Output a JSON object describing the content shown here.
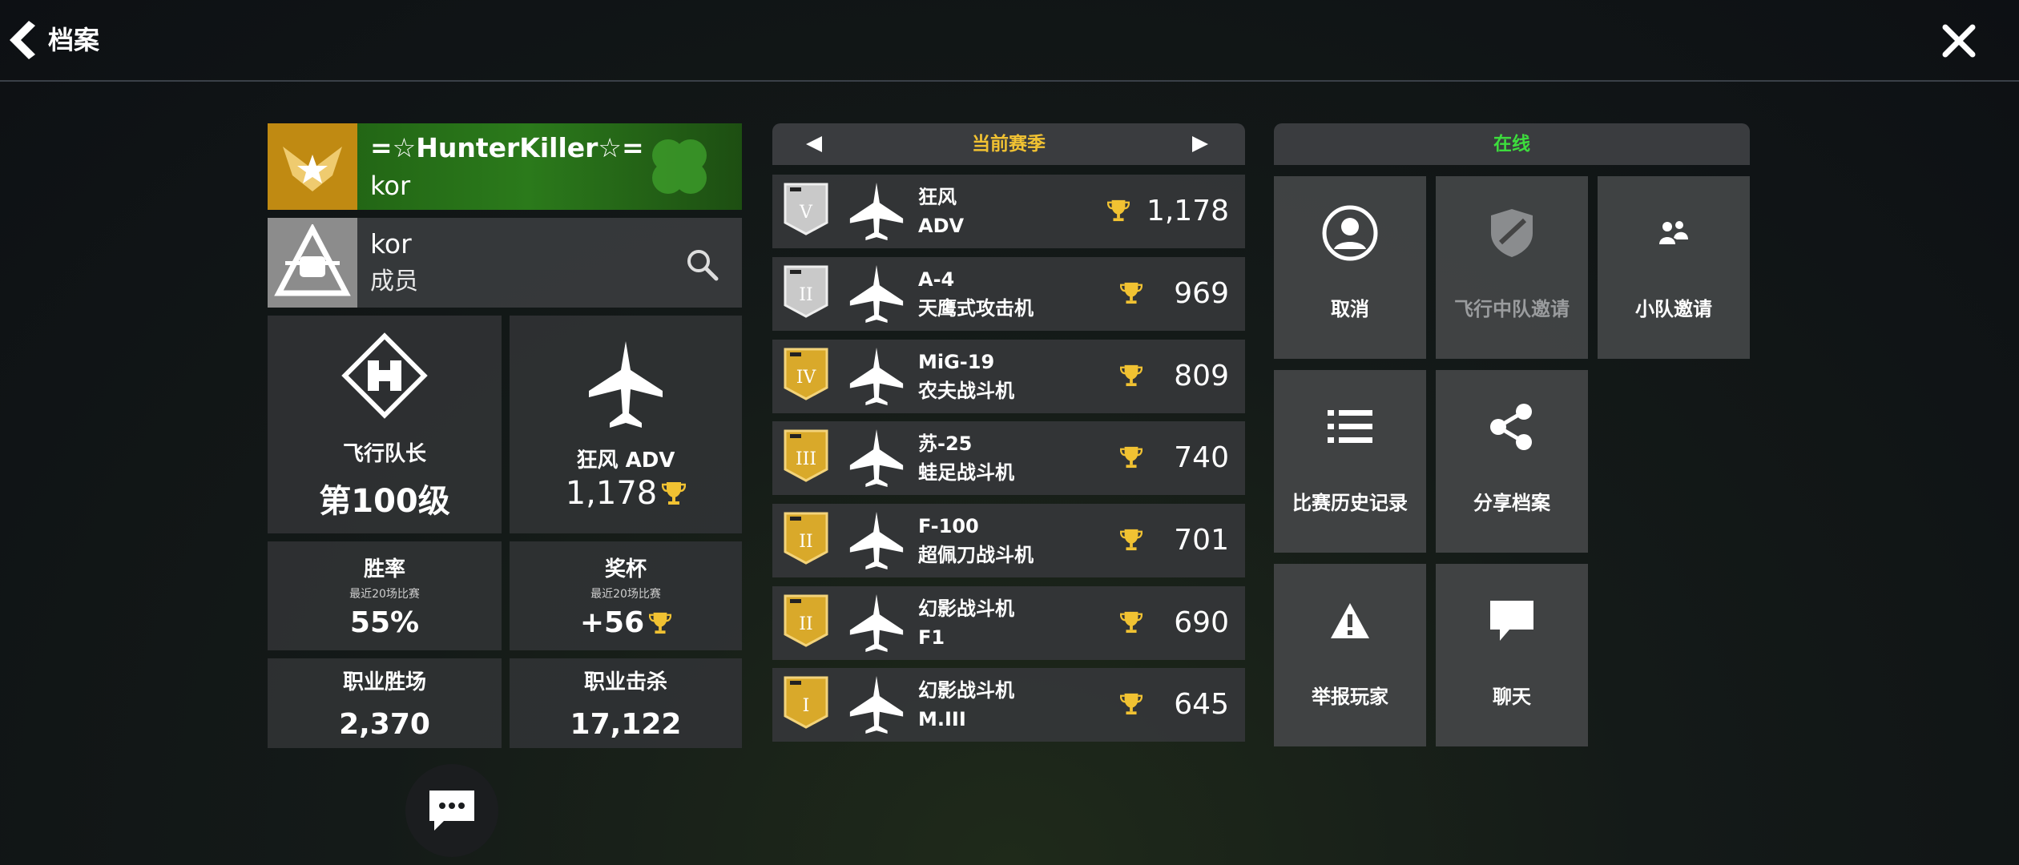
{
  "header": {
    "title": "档案"
  },
  "profile": {
    "player_name": "=☆HunterKiller☆=",
    "clan_tag": "kor"
  },
  "clan": {
    "name": "kor",
    "role": "成员"
  },
  "stats": {
    "rank_title": "飞行队长",
    "level": "第100级",
    "best_aircraft": "狂风 ADV",
    "best_aircraft_cups": "1,178",
    "win_rate_label": "胜率",
    "win_rate_sub": "最近20场比赛",
    "win_rate_value": "55%",
    "trophies_label": "奖杯",
    "trophies_sub": "最近20场比赛",
    "trophies_value": "+56",
    "career_wins_label": "职业胜场",
    "career_wins_value": "2,370",
    "career_kills_label": "职业击杀",
    "career_kills_value": "17,122"
  },
  "season": {
    "title": "当前赛季",
    "aircraft": [
      {
        "line1": "狂风",
        "line2": "ADV",
        "tier": "V",
        "cups": "1,178",
        "badge": "silver"
      },
      {
        "line1": "A-4",
        "line2": "天鹰式攻击机",
        "tier": "II",
        "cups": "969",
        "badge": "silver"
      },
      {
        "line1": "MiG-19",
        "line2": "农夫战斗机",
        "tier": "IV",
        "cups": "809",
        "badge": "gold"
      },
      {
        "line1": "苏-25",
        "line2": "蛙足战斗机",
        "tier": "III",
        "cups": "740",
        "badge": "gold"
      },
      {
        "line1": "F-100",
        "line2": "超佩刀战斗机",
        "tier": "II",
        "cups": "701",
        "badge": "gold"
      },
      {
        "line1": "幻影战斗机",
        "line2": "F1",
        "tier": "II",
        "cups": "690",
        "badge": "gold"
      },
      {
        "line1": "幻影战斗机",
        "line2": "M.III",
        "tier": "I",
        "cups": "645",
        "badge": "gold"
      }
    ]
  },
  "status": {
    "text": "在线"
  },
  "actions": {
    "cancel": "取消",
    "squadron_invite": "飞行中队邀请",
    "party_invite": "小队邀请",
    "match_history": "比赛历史记录",
    "share_profile": "分享档案",
    "report_player": "举报玩家",
    "chat": "聊天"
  },
  "colors": {
    "accent_gold": "#f1c232",
    "online_green": "#3ddc3d",
    "tile_bg": "#424446"
  }
}
